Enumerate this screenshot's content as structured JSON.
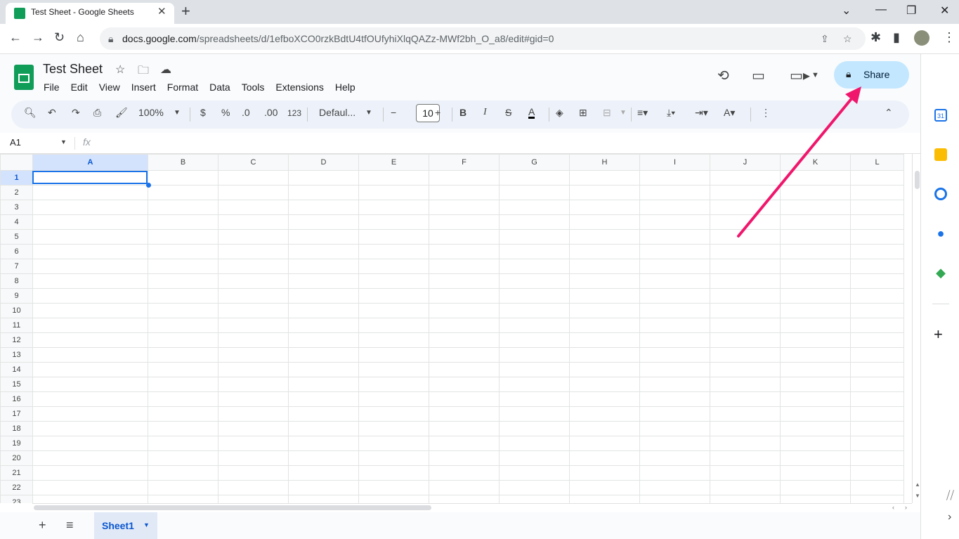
{
  "browser": {
    "tab_title": "Test Sheet - Google Sheets",
    "url_host": "docs.google.com",
    "url_path": "/spreadsheets/d/1efboXCO0rzkBdtU4tfOUfyhiXlqQAZz-MWf2bh_O_a8/edit#gid=0"
  },
  "doc": {
    "title": "Test Sheet",
    "menus": [
      "File",
      "Edit",
      "View",
      "Insert",
      "Format",
      "Data",
      "Tools",
      "Extensions",
      "Help"
    ],
    "share_label": "Share"
  },
  "toolbar": {
    "zoom": "100%",
    "currency": "$",
    "percent": "%",
    "decrease_decimal": ".0",
    "increase_decimal": ".00",
    "more_formats": "123",
    "font_family": "Defaul...",
    "font_size": "10",
    "bold": "B",
    "italic": "I",
    "strike": "S",
    "text_color": "A"
  },
  "formula_bar": {
    "name_box": "A1",
    "fx": "fx"
  },
  "grid": {
    "columns": [
      "A",
      "B",
      "C",
      "D",
      "E",
      "F",
      "G",
      "H",
      "I",
      "J",
      "K",
      "L"
    ],
    "rows": [
      "1",
      "2",
      "3",
      "4",
      "5",
      "6",
      "7",
      "8",
      "9",
      "10",
      "11",
      "12",
      "13",
      "14",
      "15",
      "16",
      "17",
      "18",
      "19",
      "20",
      "21",
      "22",
      "23"
    ],
    "selected_cell": "A1"
  },
  "sheets": {
    "active": "Sheet1"
  },
  "side_panel": {
    "calendar_day": "31"
  },
  "colors": {
    "accent": "#1a73e8",
    "share_bg": "#c2e7ff",
    "annotation_arrow": "#f0166c",
    "sheets_green": "#0f9d58"
  }
}
